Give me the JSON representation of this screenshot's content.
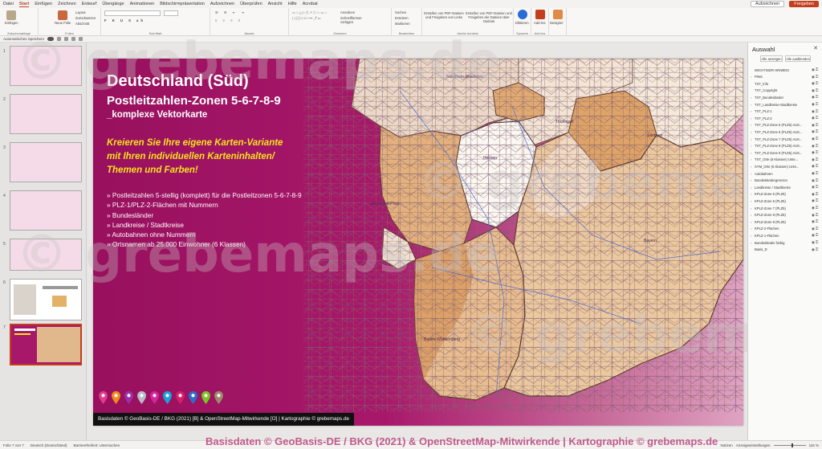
{
  "menubar": {
    "tabs": [
      "Datei",
      "Start",
      "Einfügen",
      "Zeichnen",
      "Entwurf",
      "Übergänge",
      "Animationen",
      "Bildschirmpräsentation",
      "Aufzeichnen",
      "Überprüfen",
      "Ansicht",
      "Hilfe",
      "Acrobat"
    ],
    "active_tab": "Start",
    "record_label": "Aufzeichnen",
    "share_label": "Freigeben"
  },
  "ribbon": {
    "groups": [
      "Zwischenablage",
      "Folien",
      "Schriftart",
      "Absatz",
      "Zeichnen",
      "Bearbeiten",
      "Adobe Acrobat",
      "Sprache",
      "Add-Ins",
      "Designer"
    ],
    "paste_label": "Einfügen",
    "new_slide_label": "Neue Folie",
    "layout_label": "Layout",
    "reset_label": "Zurücksetzen",
    "section_label": "Abschnitt",
    "arrange_label": "Anordnen",
    "quick_styles_label": "Schnellformat-vorlagen",
    "find_label": "Suchen",
    "replace_label": "Ersetzen",
    "select_label": "Markieren",
    "pdf_create_label": "Erstellen von PDF-Dateien und Freigeben von Links",
    "pdf_outlook_label": "Erstellen von PDF-Dateien und Freigeben der Dateien über Outlook",
    "dictate_label": "Diktieren",
    "addins_label": "Add-Ins",
    "designer_label": "Designer"
  },
  "qat": {
    "autosave_label": "Automatisches Speichern"
  },
  "thumbnails": [
    {
      "number": "1"
    },
    {
      "number": "2"
    },
    {
      "number": "3"
    },
    {
      "number": "4"
    },
    {
      "number": "5"
    },
    {
      "number": "6"
    },
    {
      "number": "7"
    }
  ],
  "slide": {
    "title": "Deutschland (Süd)",
    "subtitle": "Postleitzahlen-Zonen 5-6-7-8-9",
    "subtitle2": "_komplexe Vektorkarte",
    "promo": "Kreieren Sie Ihre eigene Karten-Variante\nmit Ihren individuellen Karteninhalten/\nThemen und Farben!",
    "bullets": [
      "» Postleitzahlen 5-stellig (komplett) für die Postleitzonen 5-6-7-8-9",
      "» PLZ-1/PLZ-2-Flächen mit Nummern",
      "» Bundesländer",
      "» Landkreise / Stadtkreise",
      "» Autobahnen ohne Nummern",
      "» Ortsnamen ab 25.000 Einwohner (6 Klassen)"
    ],
    "credit": "Basisdaten © GeoBasis-DE / BKG (2021) [B] & OpenStreetMap-Mitwirkende [O] | Kartographie © grebemaps.de",
    "map_labels": [
      "Hessen",
      "Rheinland-Pfalz",
      "Bayern",
      "Baden-Württemberg",
      "Nordrhein-Westfalen",
      "Sachsen",
      "Thüringen"
    ],
    "pin_colors": [
      "#e23b8c",
      "#f08a1c",
      "#9a2fa8",
      "#b9b9c8",
      "#d6259a",
      "#1aa3d8",
      "#d4206a",
      "#2f6cc8",
      "#7cc421",
      "#9c8a6a"
    ]
  },
  "selection_pane": {
    "title": "Auswahl",
    "show_all": "Alle anzeigen",
    "hide_all": "Alle ausblenden",
    "items": [
      {
        "name": "WICHTIGER HINWEIS",
        "expand": false
      },
      {
        "name": "PINS",
        "expand": true
      },
      {
        "name": "TXT_Info",
        "expand": false
      },
      {
        "name": "TXT_Copyright",
        "expand": false
      },
      {
        "name": "TXT_Bundesländer",
        "expand": true
      },
      {
        "name": "TXT_Landkreise-Stadtkreise",
        "expand": true
      },
      {
        "name": "TXT_PLZ-1",
        "expand": true
      },
      {
        "name": "TXT_PLZ-2",
        "expand": true
      },
      {
        "name": "TXT_PLZ-Zone 5 (PLZ5) AUS...",
        "expand": true
      },
      {
        "name": "TXT_PLZ-Zone 6 (PLZ5) AUS...",
        "expand": true
      },
      {
        "name": "TXT_PLZ-Zone 7 (PLZ5) AUS...",
        "expand": true
      },
      {
        "name": "TXT_PLZ-Zone 8 (PLZ5) AUS...",
        "expand": true
      },
      {
        "name": "TXT_PLZ-Zone 9 (PLZ5) AUS...",
        "expand": true
      },
      {
        "name": "TXT_Orte (6 Klassen) Unte...",
        "expand": true
      },
      {
        "name": "SYM_Orte (6 Klassen) Unte...",
        "expand": true
      },
      {
        "name": "Autobahnen",
        "expand": true
      },
      {
        "name": "Bundesländergrenzen",
        "expand": true
      },
      {
        "name": "Landkreise / Stadtkreise",
        "expand": true
      },
      {
        "name": "KPLZ-Zone 5 (PLZ5)",
        "expand": true
      },
      {
        "name": "KPLZ-Zone 6 (PLZ5)",
        "expand": true
      },
      {
        "name": "KPLZ-Zone 7 (PLZ5)",
        "expand": true
      },
      {
        "name": "KPLZ-Zone 8 (PLZ5)",
        "expand": true
      },
      {
        "name": "KPLZ-Zone 9 (PLZ5)",
        "expand": true
      },
      {
        "name": "KPLZ-2-Flächen",
        "expand": true
      },
      {
        "name": "KPLZ-1-Flächen",
        "expand": true
      },
      {
        "name": "Bundesländer farbig",
        "expand": true
      },
      {
        "name": "Basis_D",
        "expand": false
      }
    ]
  },
  "statusbar": {
    "slide_info": "Folie 7 von 7",
    "language": "Deutsch (Deutschland)",
    "accessibility": "Barrierefreiheit: Untersuchen",
    "notes": "Notizen",
    "display_settings": "Anzeigeeinstellungen",
    "zoom": "116 %"
  },
  "watermark": {
    "text": "© grebemaps.de",
    "footer": "Basisdaten © GeoBasis-DE / BKG (2021) & OpenStreetMap-Mitwirkende | Kartographie © grebemaps.de"
  }
}
